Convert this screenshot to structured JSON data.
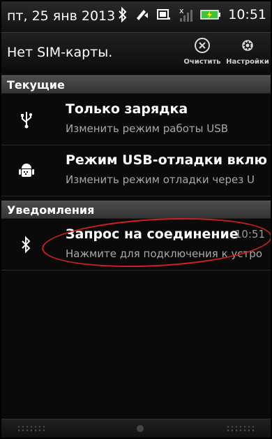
{
  "status_bar": {
    "date": "пт, 25 янв 2013",
    "time": "10:51",
    "icons": [
      "bluetooth-icon",
      "sync-icon",
      "screen-icon",
      "signal-icon",
      "battery-charging-icon"
    ]
  },
  "header": {
    "title": "Нет SIM-карты.",
    "clear_label": "Очистить",
    "settings_label": "Настройки"
  },
  "sections": {
    "current": "Текущие",
    "notifications": "Уведомления"
  },
  "ongoing": [
    {
      "icon": "usb-icon",
      "title": "Только зарядка",
      "subtitle": "Изменить режим работы USB"
    },
    {
      "icon": "android-debug-icon",
      "title": "Режим USB-отладки включе",
      "subtitle": "Изменить режим отладки через U"
    }
  ],
  "notifications": [
    {
      "icon": "bluetooth-icon",
      "title": "Запрос на соединение",
      "subtitle": "Нажмите для подключения к устро",
      "time": "10:51"
    }
  ],
  "colors": {
    "highlight": "#d21f1f",
    "battery": "#3cc33c"
  }
}
